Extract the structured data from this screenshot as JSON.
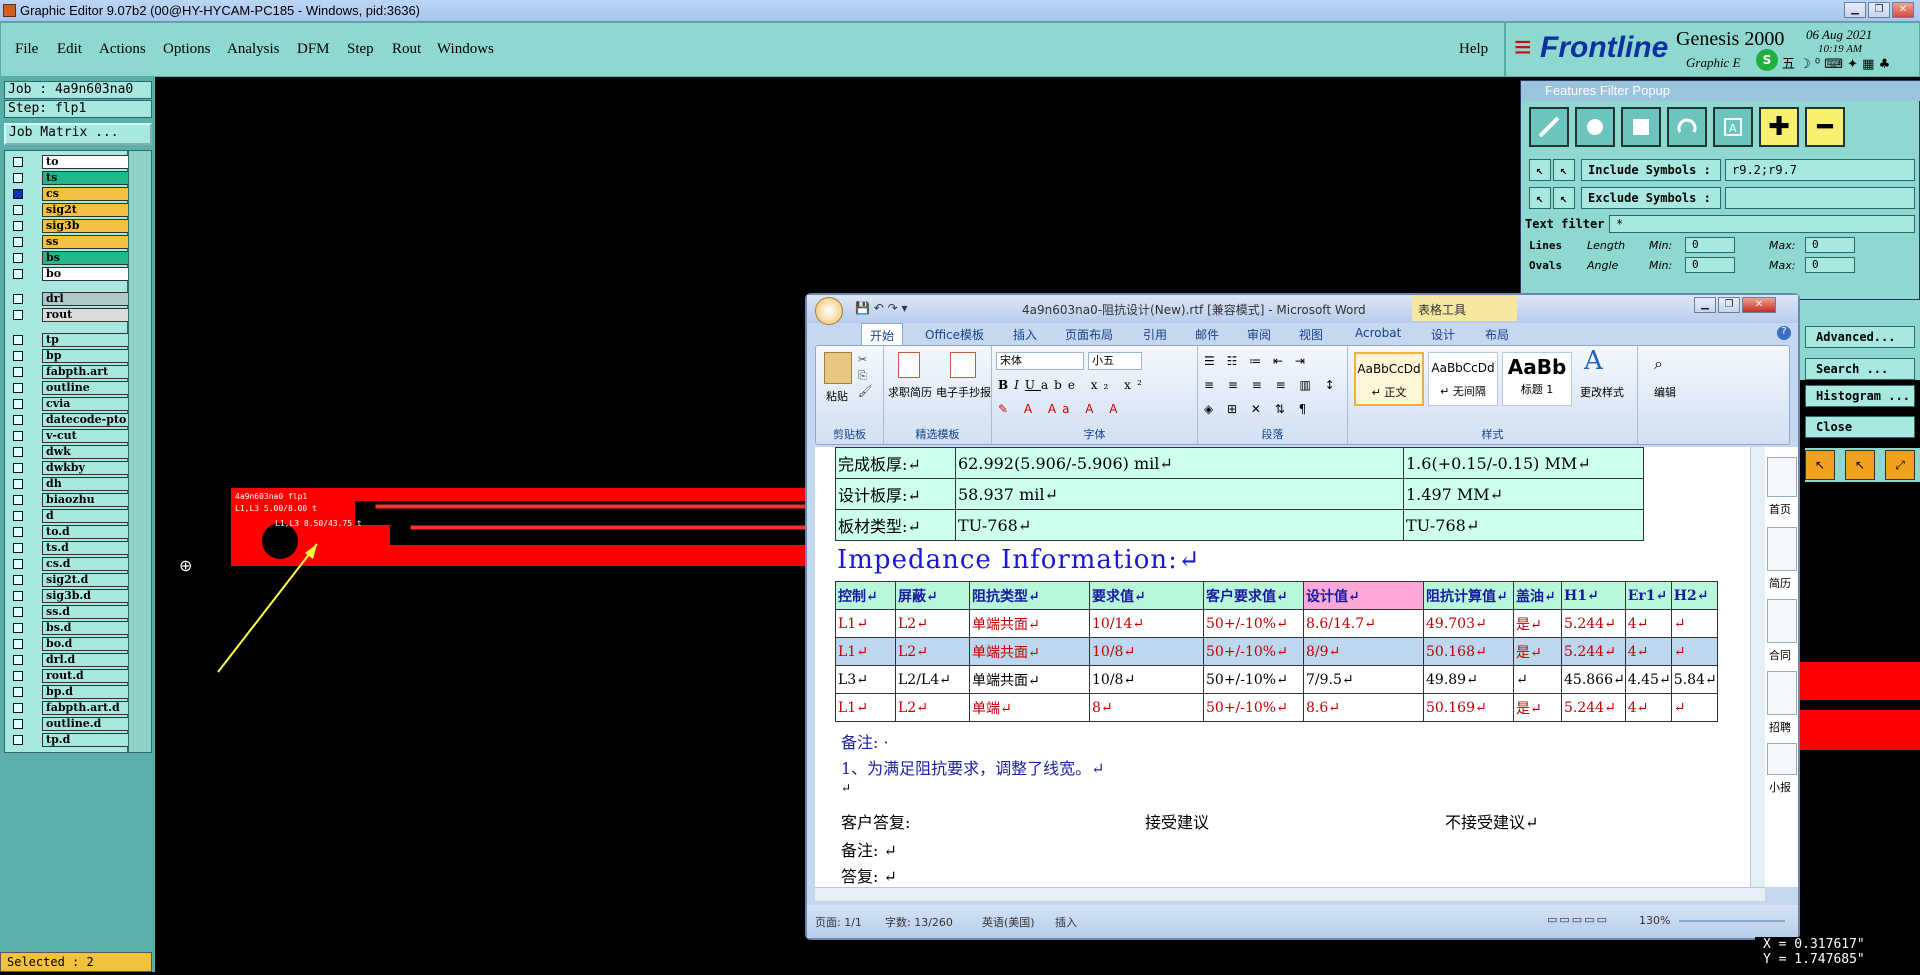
{
  "window": {
    "title": "Graphic Editor 9.07b2 (00@HY-HYCAM-PC185 - Windows, pid:3636)"
  },
  "menubar": {
    "items": [
      "File",
      "Edit",
      "Actions",
      "Options",
      "Analysis",
      "DFM",
      "Step",
      "Rout",
      "Windows"
    ],
    "help": "Help"
  },
  "logo": {
    "brand": "Frontline",
    "product": "Genesis 2000",
    "sub": "Graphic E",
    "date": "06 Aug 2021",
    "time": "10:19 AM"
  },
  "left": {
    "job": "Job : 4a9n603na0",
    "step": "Step: flp1",
    "matrix_button": "Job Matrix ...",
    "layers": [
      {
        "name": "to",
        "color": "#ffffff"
      },
      {
        "name": "ts",
        "color": "#1eb88a"
      },
      {
        "name": "cs",
        "color": "#f5c040"
      },
      {
        "name": "sig2t",
        "color": "#f5c040"
      },
      {
        "name": "sig3b",
        "color": "#f5c040"
      },
      {
        "name": "ss",
        "color": "#f5c040"
      },
      {
        "name": "bs",
        "color": "#1eb88a"
      },
      {
        "name": "bo",
        "color": "#ffffff"
      },
      {
        "name": "drl",
        "color": "#b0c8c8"
      },
      {
        "name": "rout",
        "color": "#dcdcdc"
      },
      {
        "name": "tp",
        "color": "#a8e8e0"
      },
      {
        "name": "bp",
        "color": "#a8e8e0"
      },
      {
        "name": "fabpth.art",
        "color": "#a8e8e0"
      },
      {
        "name": "outline",
        "color": "#a8e8e0"
      },
      {
        "name": "cvia",
        "color": "#a8e8e0"
      },
      {
        "name": "datecode-pto",
        "color": "#a8e8e0"
      },
      {
        "name": "v-cut",
        "color": "#a8e8e0"
      },
      {
        "name": "dwk",
        "color": "#a8e8e0"
      },
      {
        "name": "dwkby",
        "color": "#a8e8e0"
      },
      {
        "name": "dh",
        "color": "#a8e8e0"
      },
      {
        "name": "biaozhu",
        "color": "#a8e8e0"
      },
      {
        "name": "d",
        "color": "#a8e8e0"
      },
      {
        "name": "to.d",
        "color": "#a8e8e0"
      },
      {
        "name": "ts.d",
        "color": "#a8e8e0"
      },
      {
        "name": "cs.d",
        "color": "#a8e8e0"
      },
      {
        "name": "sig2t.d",
        "color": "#a8e8e0"
      },
      {
        "name": "sig3b.d",
        "color": "#a8e8e0"
      },
      {
        "name": "ss.d",
        "color": "#a8e8e0"
      },
      {
        "name": "bs.d",
        "color": "#a8e8e0"
      },
      {
        "name": "bo.d",
        "color": "#a8e8e0"
      },
      {
        "name": "drl.d",
        "color": "#a8e8e0"
      },
      {
        "name": "rout.d",
        "color": "#a8e8e0"
      },
      {
        "name": "bp.d",
        "color": "#a8e8e0"
      },
      {
        "name": "fabpth.art.d",
        "color": "#a8e8e0"
      },
      {
        "name": "outline.d",
        "color": "#a8e8e0"
      },
      {
        "name": "tp.d",
        "color": "#a8e8e0"
      }
    ],
    "selected": "Selected : 2"
  },
  "canvas": {
    "label1": "4a9n603na0 flp1",
    "label2": "L1,L3 5.00/8.00 t",
    "label3": "L1,L3 8.50/43.75 t"
  },
  "ffp": {
    "title": "Features Filter Popup",
    "include_label": "Include Symbols :",
    "include_value": "r9.2;r9.7",
    "exclude_label": "Exclude Symbols :",
    "exclude_value": "",
    "text_filter_label": "Text filter",
    "text_filter_value": "*",
    "lines": "Lines",
    "ovals": "Ovals",
    "length": "Length",
    "angle": "Angle",
    "min": "Min:",
    "max": "Max:",
    "zero": "0"
  },
  "side_buttons": [
    "Advanced...",
    "Search ...",
    "Histogram ...",
    "Close"
  ],
  "word": {
    "title": "4a9n603na0-阻抗设计(New).rtf [兼容模式] - Microsoft Word",
    "context_tab": "表格工具",
    "tabs": [
      "开始",
      "Office模板",
      "插入",
      "页面布局",
      "引用",
      "邮件",
      "审阅",
      "视图",
      "Acrobat",
      "设计",
      "布局"
    ],
    "ribbon": {
      "paste": "粘贴",
      "clipboard": "剪贴板",
      "resume": "求职简历",
      "handbill": "电子手抄报",
      "templates": "精选模板",
      "font_name": "宋体",
      "font_size": "小五",
      "font": "字体",
      "paragraph": "段落",
      "styles_group": "样式",
      "change_styles": "更改样式",
      "edit": "编辑",
      "styles": [
        {
          "sample": "AaBbCcDd",
          "name": "↵ 正文"
        },
        {
          "sample": "AaBbCcDd",
          "name": "↵ 无间隔"
        },
        {
          "sample": "AaBb",
          "name": "标题 1"
        }
      ]
    },
    "board": [
      [
        "完成板厚:↵",
        "62.992(5.906/-5.906) mil↵",
        "1.6(+0.15/-0.15) MM↵"
      ],
      [
        "设计板厚:↵",
        "58.937 mil↵",
        "1.497 MM↵"
      ],
      [
        "板材类型:↵",
        "TU-768↵",
        "TU-768↵"
      ]
    ],
    "impedance_title": "Impedance Information:↵",
    "headers": [
      "控制↵",
      "屏蔽↵",
      "阻抗类型↵",
      "要求值↵",
      "客户要求值↵",
      "设计值↵",
      "阻抗计算值↵",
      "盖油↵",
      "H1↵",
      "Er1↵",
      "H2↵"
    ],
    "rows": [
      [
        "L1↵",
        "L2↵",
        "单端共面↵",
        "10/14↵",
        "50+/-10%↵",
        "8.6/14.7↵",
        "49.703↵",
        "是↵",
        "5.244↵",
        "4↵",
        "↵"
      ],
      [
        "L1↵",
        "L2↵",
        "单端共面↵",
        "10/8↵",
        "50+/-10%↵",
        "8/9↵",
        "50.168↵",
        "是↵",
        "5.244↵",
        "4↵",
        "↵"
      ],
      [
        "L3↵",
        "L2/L4↵",
        "单端共面↵",
        "10/8↵",
        "50+/-10%↵",
        "7/9.5↵",
        "49.89↵",
        "↵",
        "45.866↵",
        "4.45↵",
        "5.84↵"
      ],
      [
        "L1↵",
        "L2↵",
        "单端↵",
        "8↵",
        "50+/-10%↵",
        "8.6↵",
        "50.169↵",
        "是↵",
        "5.244↵",
        "4↵",
        "↵"
      ]
    ],
    "note_label": "备注: ·",
    "note_line": "1、为满足阻抗要求，调整了线宽。↵",
    "blank": "↵",
    "reply_label": "客户答复:",
    "accept": "接受建议",
    "reject": "不接受建议↵",
    "note2": "备注: ↵",
    "reply2": "答复: ↵",
    "nav": [
      "首页",
      "简历",
      "合同",
      "招聘",
      "小报"
    ],
    "status": {
      "page": "页面: 1/1",
      "words": "字数: 13/260",
      "lang": "英语(美国)",
      "mode": "插入",
      "zoom": "130%"
    }
  },
  "coords": {
    "x": "X = 0.317617\"",
    "y": "Y = 1.747685\""
  }
}
